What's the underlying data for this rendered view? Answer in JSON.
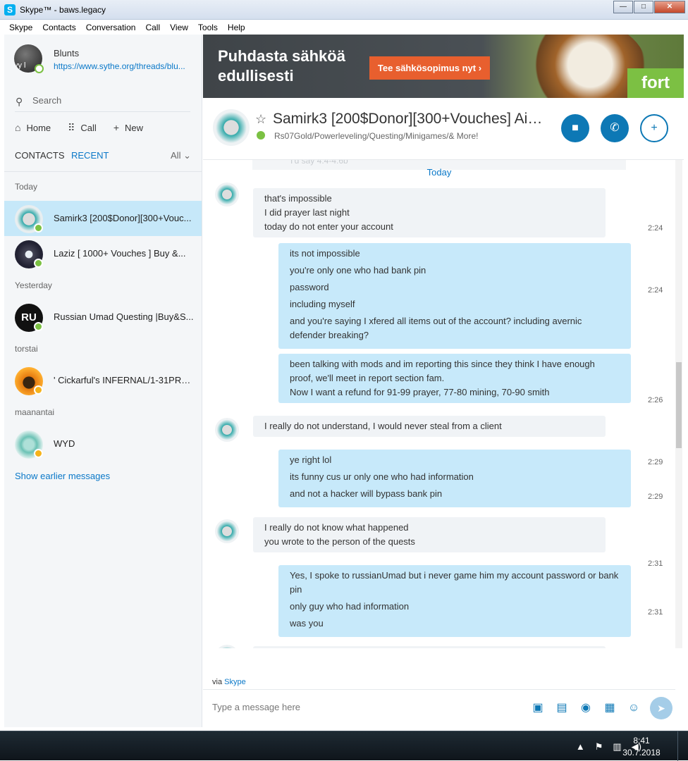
{
  "window": {
    "title": "Skype™ - baws.legacy",
    "app_icon": "S",
    "min": "—",
    "max": "□",
    "close": "✕"
  },
  "menu": [
    "Skype",
    "Contacts",
    "Conversation",
    "Call",
    "View",
    "Tools",
    "Help"
  ],
  "profile": {
    "name": "Blunts",
    "link": "https://www.sythe.org/threads/blu...",
    "initials": "vy l",
    "status_color": "#7bc143"
  },
  "search": {
    "placeholder": "Search"
  },
  "nav": {
    "home": "Home",
    "call": "Call",
    "new": "New"
  },
  "tabs": {
    "contacts": "CONTACTS",
    "recent": "RECENT",
    "filter": "All"
  },
  "sections": {
    "today": "Today",
    "yesterday": "Yesterday",
    "torstai": "torstai",
    "maanantai": "maanantai"
  },
  "conversations": [
    {
      "name": "Samirk3 [200$Donor][300+Vouc...",
      "status": "online"
    },
    {
      "name": "Laziz [ 1000+ Vouches ] Buy &...",
      "status": "online"
    },
    {
      "name": "Russian Umad Questing |Buy&S...",
      "status": "online",
      "avatar_text": "RU"
    },
    {
      "name": "' Cickarful's INFERNAL/1-31PRA...",
      "status": "away"
    },
    {
      "name": "WYD",
      "status": "away"
    }
  ],
  "show_earlier": "Show earlier messages",
  "ad": {
    "headline_1": "Puhdasta sähköä",
    "headline_2": "edullisesti",
    "cta": "Tee sähkösopimus nyt ›",
    "brand": "fort"
  },
  "chat": {
    "title": "Samirk3 [200$Donor][300+Vouches] Aio...",
    "subtitle": "Rs07Gold/Powerleveling/Questing/Minigames/& More!",
    "date_label": "Today",
    "faded_preview": "I'd say 4.4-4.6b"
  },
  "messages": [
    {
      "dir": "in",
      "time": "2:24",
      "lines": [
        "that's impossible",
        "I did prayer last night",
        "today do not enter your account"
      ]
    },
    {
      "dir": "out",
      "time": "2:24",
      "lines": [
        "its not impossible",
        "you're only one who had bank pin",
        "password",
        "including myself",
        "and you're saying I xfered all items out of the account? including avernic defender breaking?"
      ]
    },
    {
      "dir": "out",
      "time": "2:26",
      "lines": [
        "been talking with mods and im reporting this since they think I have enough proof, we'll meet in report section fam.",
        "Now I want a refund for 91-99 prayer, 77-80 mining, 70-90 smith"
      ]
    },
    {
      "dir": "in",
      "time": "2:29",
      "lines": [
        "I really do not understand, I would never steal from a client"
      ]
    },
    {
      "dir": "out",
      "time": "2:29",
      "lines": [
        "ye right lol",
        "its funny cus ur only one who had information",
        "and not a hacker will bypass bank pin"
      ]
    },
    {
      "dir": "in",
      "time": "2:31",
      "lines": [
        "I really do not know what happened",
        "you wrote to the person of the quests"
      ]
    },
    {
      "dir": "out",
      "time": "2:31",
      "lines": [
        "Yes, I spoke to russianUmad but i never game him my account password or bank pin",
        "only guy who had information",
        "was you"
      ]
    }
  ],
  "via": {
    "prefix": "via",
    "link": "Skype"
  },
  "compose": {
    "placeholder": "Type a message here"
  },
  "taskbar": {
    "time": "8:41",
    "date": "30.7.2018"
  },
  "colors": {
    "accent": "#0d78b5",
    "link": "#0a78c8",
    "selected": "#c6e8f9",
    "outgoing": "#c7e9fa",
    "incoming": "#f0f3f6",
    "online": "#7bc143",
    "away": "#f6b31b"
  }
}
